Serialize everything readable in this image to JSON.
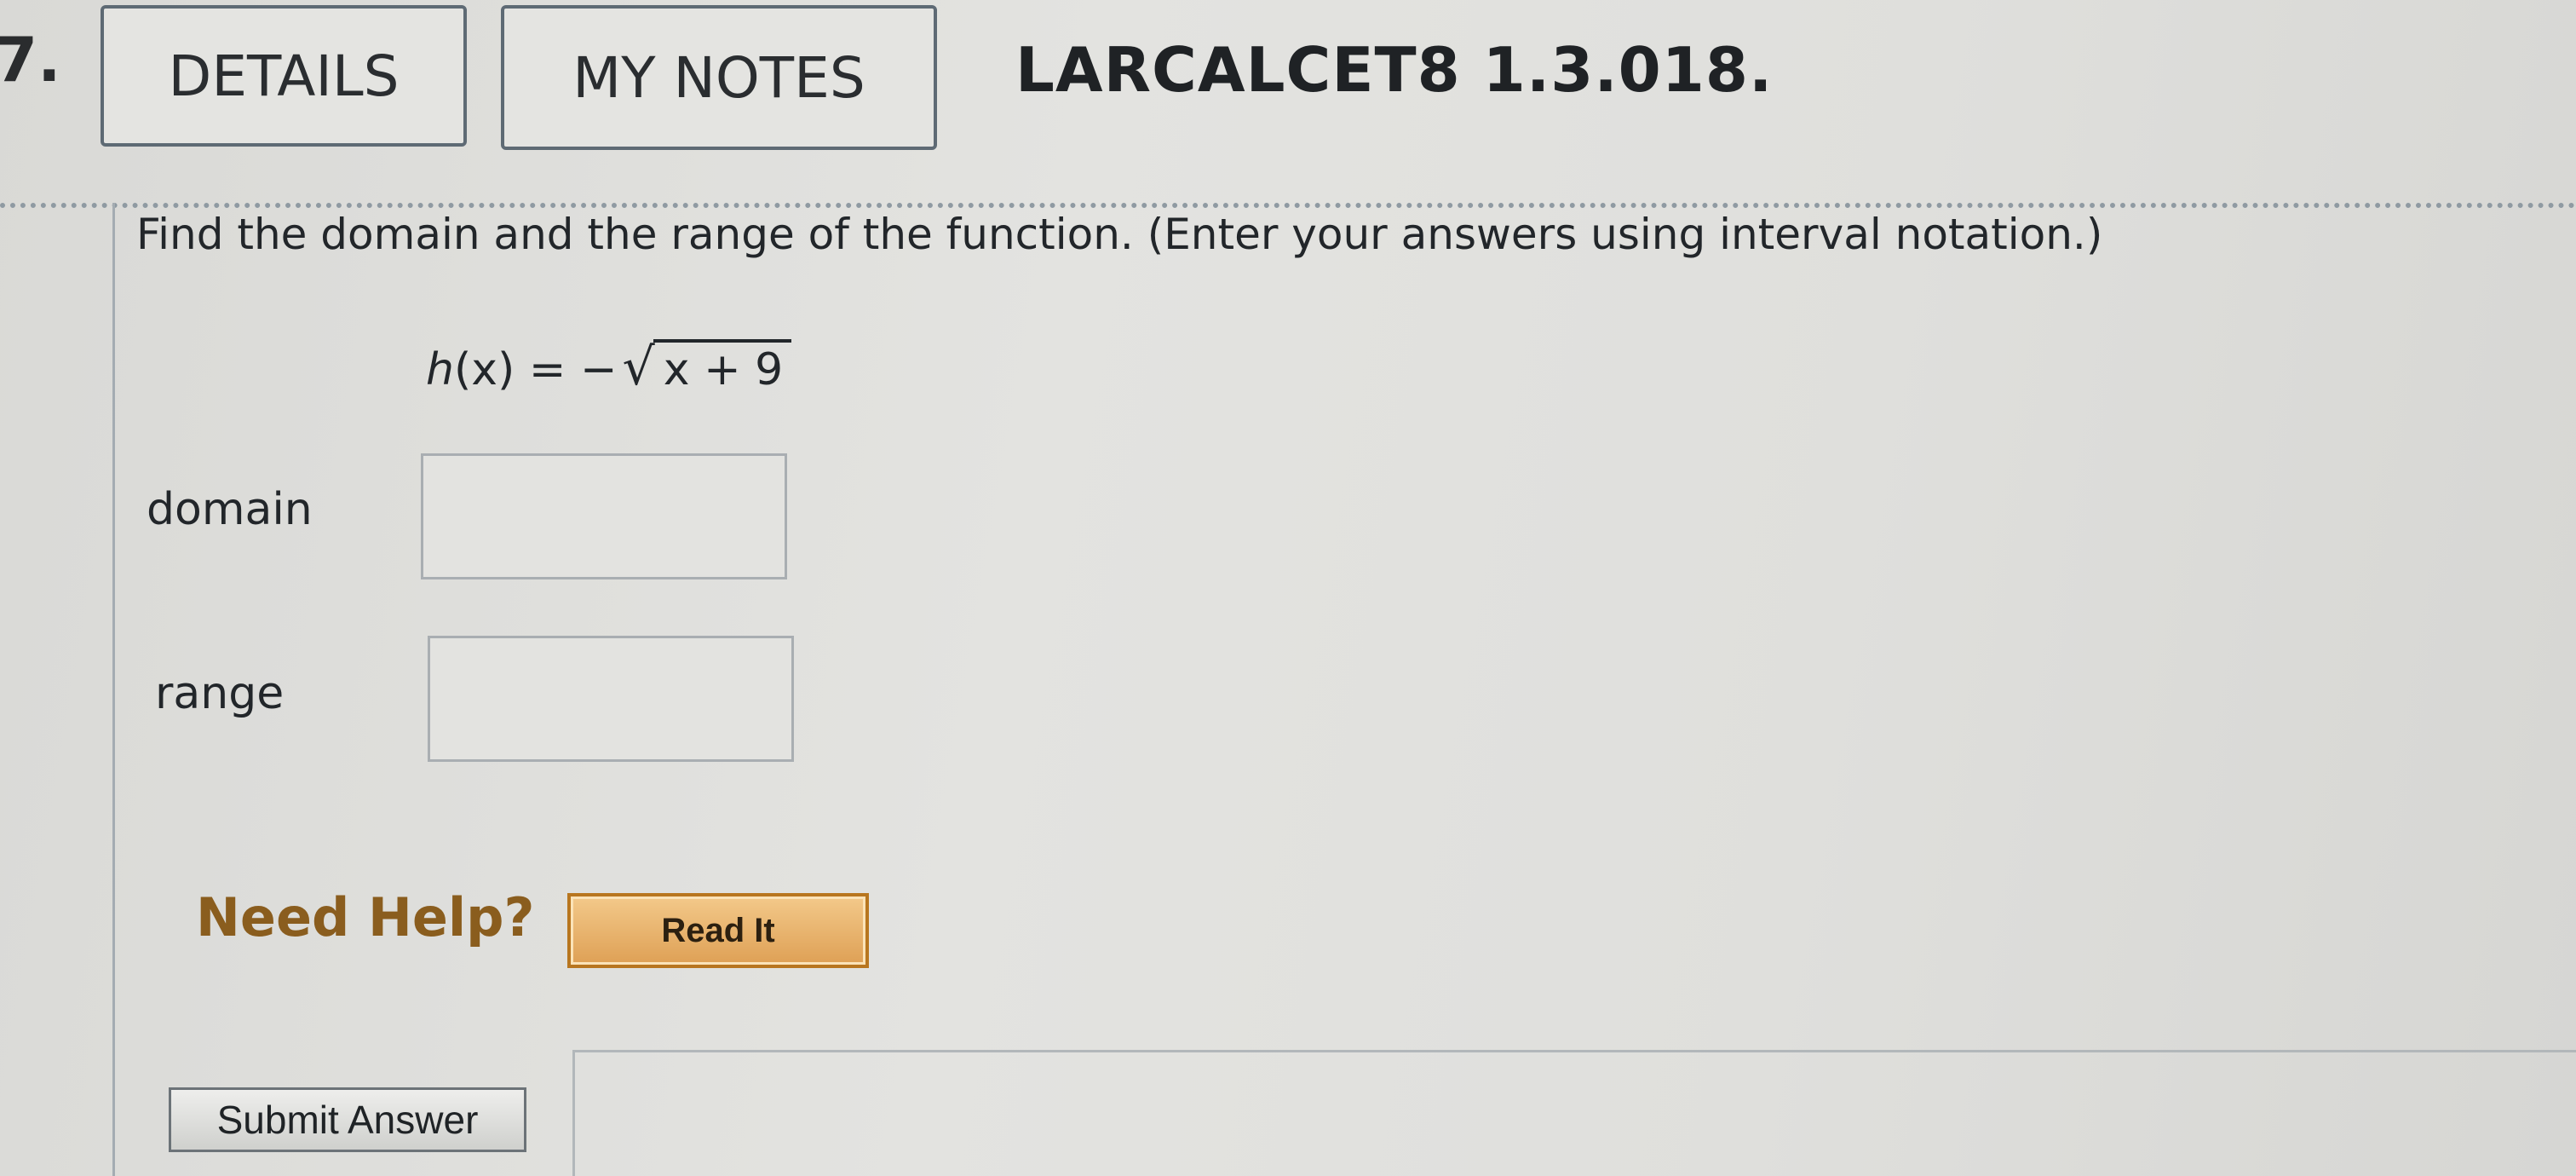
{
  "question": {
    "number": "7.",
    "reference": "LARCALCET8 1.3.018.",
    "prompt": "Find the domain and the range of the function. (Enter your answers using interval notation.)"
  },
  "header": {
    "details_label": "DETAILS",
    "notes_label": "MY NOTES"
  },
  "formula": {
    "lhs_func": "h",
    "lhs_var": "(x)",
    "equals": " = −",
    "radical": "√",
    "radicand": "x + 9"
  },
  "fields": {
    "domain_label": "domain",
    "domain_value": "",
    "range_label": "range",
    "range_value": ""
  },
  "help": {
    "label": "Need Help?",
    "read_button": "Read It"
  },
  "actions": {
    "submit_label": "Submit Answer"
  },
  "colors": {
    "help_text": "#8a5d1e",
    "read_button_fill": "#dea055",
    "read_button_border": "#b8761f"
  }
}
